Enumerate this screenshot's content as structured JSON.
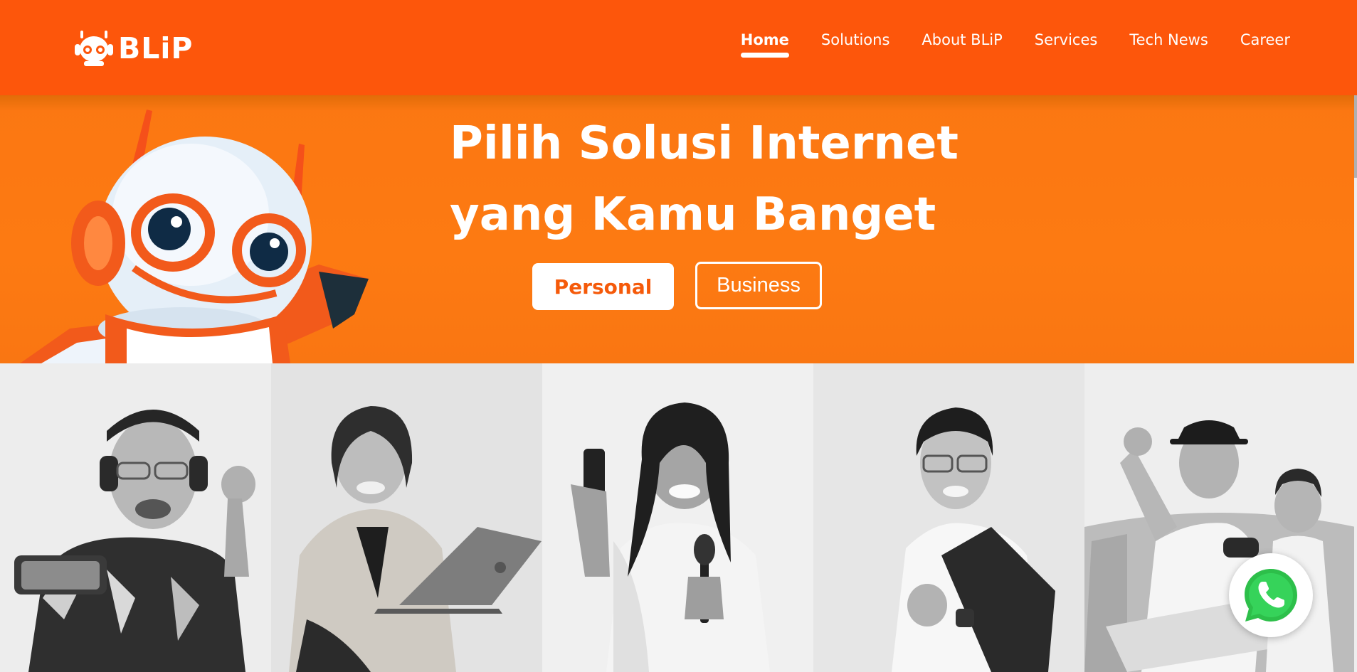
{
  "brand": {
    "name": "BLiP",
    "accent": "#fd560b",
    "hero_color": "#fb7712"
  },
  "nav": {
    "items": [
      {
        "label": "Home",
        "active": true
      },
      {
        "label": "Solutions"
      },
      {
        "label": "About BLiP"
      },
      {
        "label": "Services"
      },
      {
        "label": "Tech News"
      },
      {
        "label": "Career"
      }
    ]
  },
  "hero": {
    "title_line1": "Pilih Solusi Internet",
    "title_line2": "yang Kamu Banget",
    "personal_label": "Personal",
    "business_label": "Business"
  },
  "photos": [
    "gamer-with-headphones",
    "woman-with-laptop",
    "woman-with-phone-and-brush",
    "student-with-backpack",
    "father-and-son-gaming"
  ],
  "floating": {
    "whatsapp_icon": "whatsapp-icon"
  }
}
